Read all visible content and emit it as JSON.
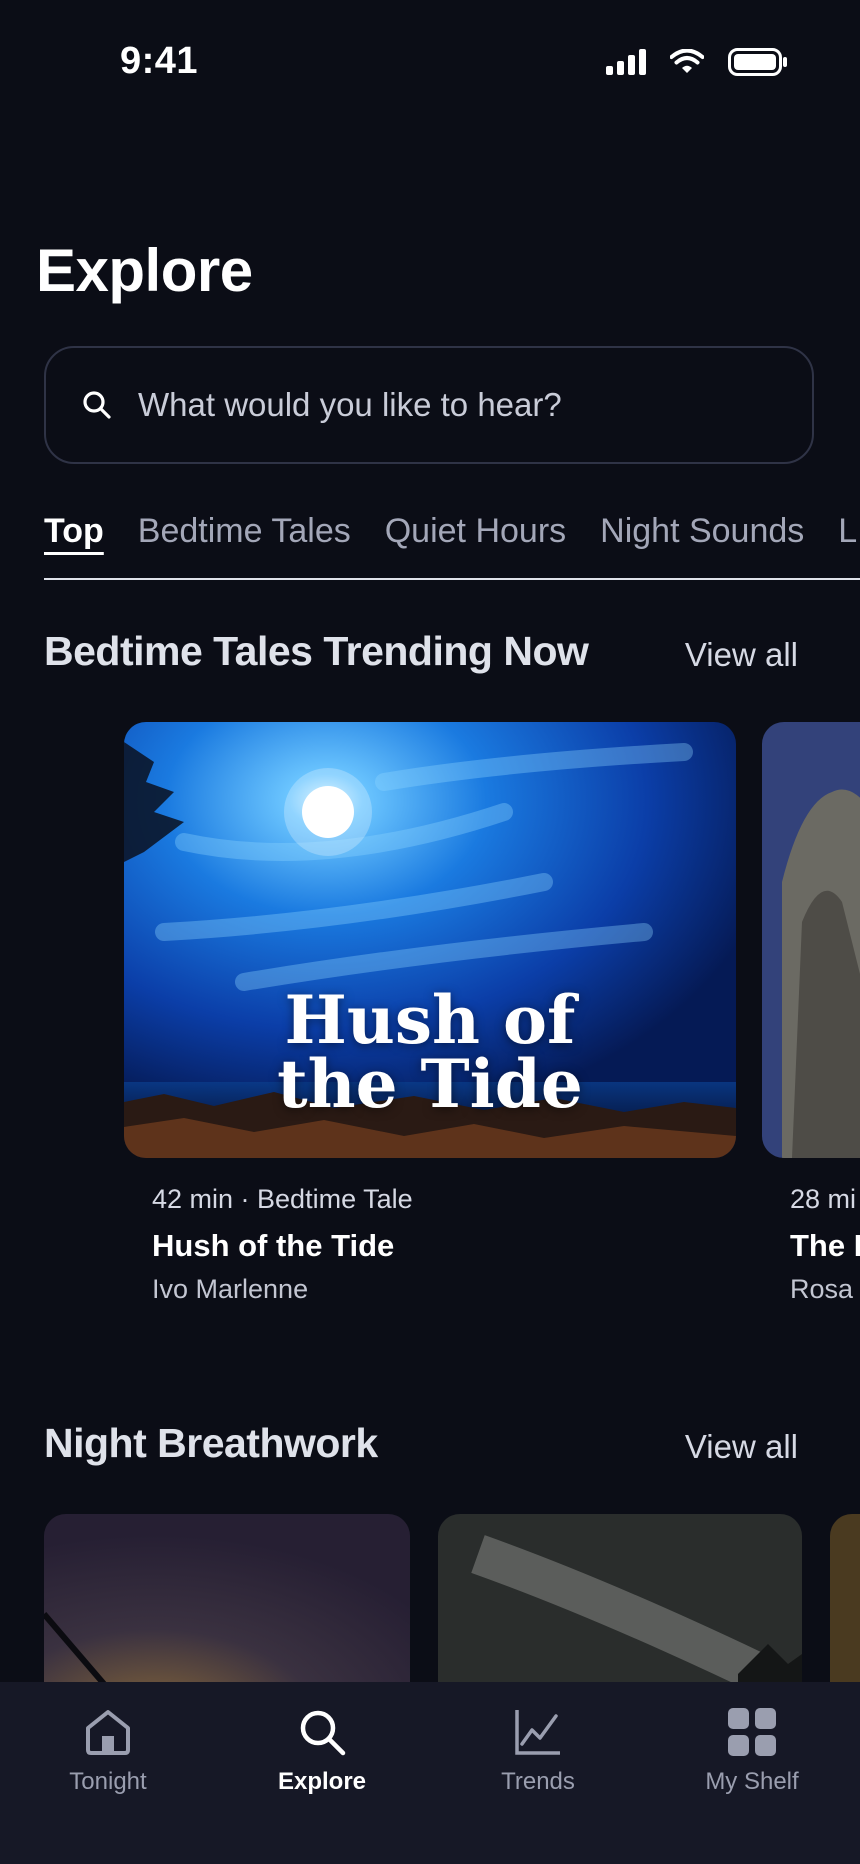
{
  "status_bar": {
    "time": "9:41"
  },
  "page": {
    "title": "Explore"
  },
  "search": {
    "placeholder": "What would you like to hear?"
  },
  "tabs": [
    {
      "label": "Top",
      "active": true
    },
    {
      "label": "Bedtime Tales"
    },
    {
      "label": "Quiet Hours"
    },
    {
      "label": "Night Sounds"
    },
    {
      "label": "L"
    }
  ],
  "sections": {
    "trending": {
      "title": "Bedtime Tales Trending Now",
      "view_all": "View all",
      "featured": {
        "cover_title_line1": "Hush of",
        "cover_title_line2": "the Tide",
        "meta": "42 min · Bedtime Tale",
        "title": "Hush of the Tide",
        "author": "Ivo Marlenne"
      },
      "next": {
        "meta": "28 mi",
        "title": "The I",
        "author": "Rosa"
      }
    },
    "breathwork": {
      "title": "Night Breathwork",
      "view_all": "View all"
    }
  },
  "tabbar": [
    {
      "label": "Tonight",
      "icon": "home-icon"
    },
    {
      "label": "Explore",
      "icon": "search-icon",
      "active": true
    },
    {
      "label": "Trends",
      "icon": "trend-chart-icon"
    },
    {
      "label": "My Shelf",
      "icon": "grid-icon"
    }
  ]
}
